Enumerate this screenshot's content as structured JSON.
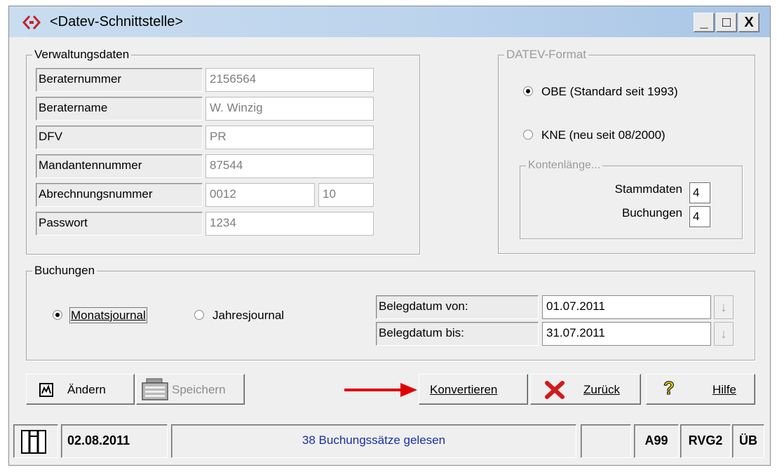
{
  "window": {
    "title": "<Datev-Schnittstelle>",
    "controls": {
      "minimize": "_",
      "maximize": "□",
      "close": "X"
    }
  },
  "verwaltungsdaten": {
    "title": "Verwaltungsdaten",
    "rows": [
      {
        "label": "Beraternummer",
        "value": "2156564"
      },
      {
        "label": "Beratername",
        "value": "W. Winzig"
      },
      {
        "label": "DFV",
        "value": "PR"
      },
      {
        "label": "Mandantennummer",
        "value": "87544"
      },
      {
        "label": "Abrechnungsnummer",
        "value": "0012",
        "value2": "10"
      },
      {
        "label": "Passwort",
        "value": "1234"
      }
    ]
  },
  "datev_format": {
    "title": "DATEV-Format",
    "options": [
      {
        "label": "OBE (Standard seit 1993)",
        "checked": true
      },
      {
        "label": "KNE (neu seit 08/2000)",
        "checked": false
      }
    ],
    "kontenlaenge": {
      "title": "Kontenlänge...",
      "stammdaten_label": "Stammdaten",
      "stammdaten_value": "4",
      "buchungen_label": "Buchungen",
      "buchungen_value": "4"
    }
  },
  "buchungen": {
    "title": "Buchungen",
    "radio_monats": {
      "label": "Monatsjournal",
      "checked": true
    },
    "radio_jahres": {
      "label": "Jahresjournal",
      "checked": false
    },
    "belegdatum_von_label": "Belegdatum von:",
    "belegdatum_von_value": "01.07.2011",
    "belegdatum_bis_label": "Belegdatum bis:",
    "belegdatum_bis_value": "31.07.2011"
  },
  "buttons": {
    "aendern": "Ändern",
    "speichern": "Speichern",
    "konvertieren": "Konvertieren",
    "zurueck": "Zurück",
    "hilfe": "Hilfe"
  },
  "statusbar": {
    "date": "02.08.2011",
    "message": "38 Buchungssätze gelesen",
    "empty": "",
    "code1": "A99",
    "code2": "RVG2",
    "code3": "ÜB"
  },
  "colors": {
    "titlebar": "#bcd3ec",
    "status_message": "#1a2fa8",
    "arrow": "#e00000",
    "zurueck_icon": "#d21a1a",
    "hilfe_icon": "#e6d200"
  },
  "icons": {
    "app": "app-diamond-icon",
    "aendern": "edit-icon",
    "speichern": "save-icon",
    "zurueck": "red-x-icon",
    "hilfe": "question-icon",
    "statusbar": "grid-icon",
    "annotation": "red-arrow-icon"
  }
}
